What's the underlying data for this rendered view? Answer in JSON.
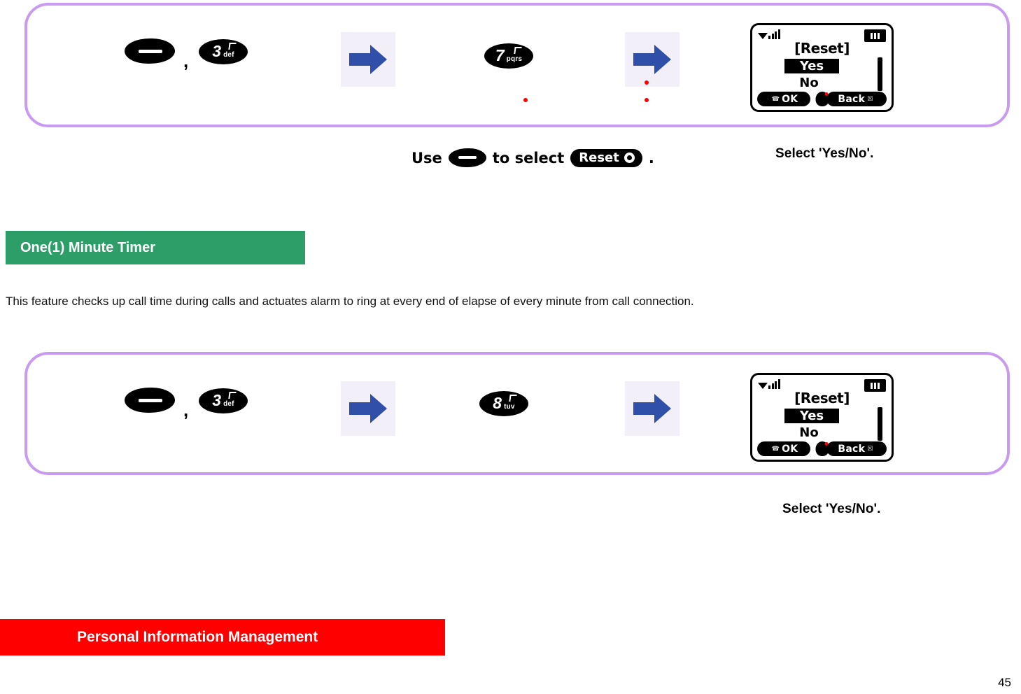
{
  "page": {
    "number": "45",
    "background": "#ffffff"
  },
  "colors": {
    "step_box_border": "#c89af2",
    "green_header_bg": "#2e9e68",
    "red_header_bg": "#fe0000",
    "arrow_blue": "#2f4fa8",
    "arrow_tile_bg": "#f3eff9",
    "red_dot": "#ff0000"
  },
  "step_sequence_1": {
    "keys": [
      {
        "type": "nav-key",
        "label": ""
      },
      {
        "type": "number-key",
        "digit": "3",
        "letters": "def"
      }
    ],
    "separator": ",",
    "arrow_1": "right-arrow-icon",
    "key_2": {
      "type": "number-key",
      "digit": "7",
      "letters": "pqrs"
    },
    "arrow_2": "right-arrow-icon",
    "phone": {
      "title": "[Reset]",
      "option_selected": "Yes",
      "option_other": "No",
      "softkey_left": "OK",
      "softkey_right": "Back",
      "status_signal": "signal-icon",
      "status_battery": "battery-icon"
    }
  },
  "captions_1": {
    "use_prefix": "Use",
    "use_middle": "to select",
    "reset_badge": "Reset",
    "use_suffix": ".",
    "select_yes_no": "Select 'Yes/No'."
  },
  "section_green": {
    "title": "One(1) Minute Timer"
  },
  "description": {
    "text": "This feature checks up call time during calls and actuates alarm to ring at every end of elapse of every minute from call connection."
  },
  "step_sequence_2": {
    "keys": [
      {
        "type": "nav-key",
        "label": ""
      },
      {
        "type": "number-key",
        "digit": "3",
        "letters": "def"
      }
    ],
    "separator": ",",
    "arrow_1": "right-arrow-icon",
    "key_2": {
      "type": "number-key",
      "digit": "8",
      "letters": "tuv"
    },
    "arrow_2": "right-arrow-icon",
    "phone": {
      "title": "[Reset]",
      "option_selected": "Yes",
      "option_other": "No",
      "softkey_left": "OK",
      "softkey_right": "Back",
      "status_signal": "signal-icon",
      "status_battery": "battery-icon"
    }
  },
  "captions_2": {
    "select_yes_no": "Select 'Yes/No'."
  },
  "section_red": {
    "title": "Personal Information Management"
  }
}
